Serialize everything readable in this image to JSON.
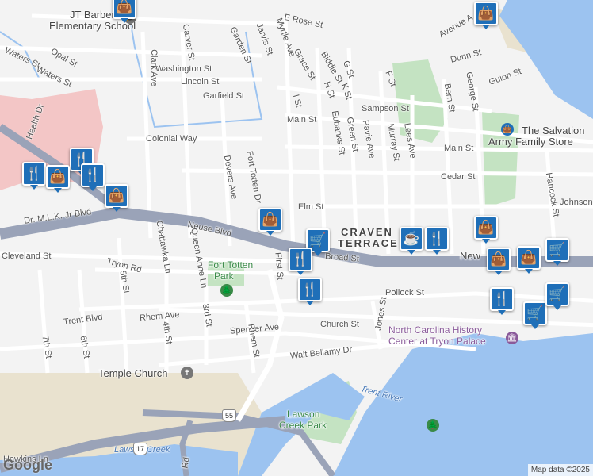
{
  "map": {
    "attribution": "Map data ©2025",
    "logo": "Google",
    "colors": {
      "water": "#9cc3f0",
      "park": "#c4e3c2",
      "highway": "#9aa3b8",
      "hospital": "#f3c6c6",
      "sand": "#e9e2cf",
      "pin": "#1f6fb8"
    }
  },
  "district": {
    "line1": "CRAVEN",
    "line2": "TERRACE"
  },
  "streets": [
    {
      "id": "jt-barber",
      "text": "JT Barber"
    },
    {
      "id": "jt-barber-2",
      "text": "Elementary School"
    },
    {
      "id": "e-rose",
      "text": "E Rose St"
    },
    {
      "id": "opal",
      "text": "Opal St"
    },
    {
      "id": "waters-1",
      "text": "Waters St"
    },
    {
      "id": "waters-2",
      "text": "Waters St"
    },
    {
      "id": "clark",
      "text": "Clark Ave"
    },
    {
      "id": "carver",
      "text": "Carver St"
    },
    {
      "id": "garden",
      "text": "Garden St"
    },
    {
      "id": "jarvis",
      "text": "Jarvis St"
    },
    {
      "id": "myrtle",
      "text": "Myrtle Ave"
    },
    {
      "id": "washington",
      "text": "Washington St"
    },
    {
      "id": "lincoln",
      "text": "Lincoln St"
    },
    {
      "id": "garfield",
      "text": "Garfield St"
    },
    {
      "id": "grace",
      "text": "Grace St"
    },
    {
      "id": "biddle",
      "text": "Biddle St"
    },
    {
      "id": "g-st",
      "text": "G St"
    },
    {
      "id": "f-st",
      "text": "F St"
    },
    {
      "id": "h-st",
      "text": "H St"
    },
    {
      "id": "k-st",
      "text": "K St"
    },
    {
      "id": "i-st",
      "text": "I St"
    },
    {
      "id": "sampson",
      "text": "Sampson St"
    },
    {
      "id": "main-1",
      "text": "Main St"
    },
    {
      "id": "main-2",
      "text": "Main St"
    },
    {
      "id": "eubanks",
      "text": "Eubanks St"
    },
    {
      "id": "green",
      "text": "Green St"
    },
    {
      "id": "pavie",
      "text": "Pavie Ave"
    },
    {
      "id": "murray",
      "text": "Murray St"
    },
    {
      "id": "lees",
      "text": "Lees Ave"
    },
    {
      "id": "bern",
      "text": "Bern St"
    },
    {
      "id": "george",
      "text": "George St"
    },
    {
      "id": "avenue-a",
      "text": "Avenue A"
    },
    {
      "id": "dunn",
      "text": "Dunn St"
    },
    {
      "id": "guion",
      "text": "Guion St"
    },
    {
      "id": "health",
      "text": "Health Dr"
    },
    {
      "id": "colonial",
      "text": "Colonial Way"
    },
    {
      "id": "devers",
      "text": "Devers Ave"
    },
    {
      "id": "fort-totten-dr",
      "text": "Fort Totten Dr"
    },
    {
      "id": "cedar",
      "text": "Cedar St"
    },
    {
      "id": "elm",
      "text": "Elm St"
    },
    {
      "id": "johnson",
      "text": "Johnson"
    },
    {
      "id": "hancock",
      "text": "Hancock St"
    },
    {
      "id": "mlk",
      "text": "Dr. M.L.K. Jr Blvd"
    },
    {
      "id": "neuse",
      "text": "Neuse Blvd"
    },
    {
      "id": "broad",
      "text": "Broad St"
    },
    {
      "id": "new",
      "text": "New"
    },
    {
      "id": "cleveland",
      "text": "Cleveland St"
    },
    {
      "id": "tryon",
      "text": "Tryon Rd"
    },
    {
      "id": "chattawka",
      "text": "Chattawka Ln"
    },
    {
      "id": "queen-anne",
      "text": "Queen Anne Ln"
    },
    {
      "id": "fifth",
      "text": "5th St"
    },
    {
      "id": "first",
      "text": "First St"
    },
    {
      "id": "pollock",
      "text": "Pollock St"
    },
    {
      "id": "trent-blvd",
      "text": "Trent Blvd"
    },
    {
      "id": "rhem-ave",
      "text": "Rhem Ave"
    },
    {
      "id": "third",
      "text": "3rd St"
    },
    {
      "id": "fourth",
      "text": "4th St"
    },
    {
      "id": "sixth",
      "text": "6th St"
    },
    {
      "id": "seventh",
      "text": "7th St"
    },
    {
      "id": "spencer",
      "text": "Spencer Ave"
    },
    {
      "id": "rhem-st",
      "text": "Rhem St"
    },
    {
      "id": "church",
      "text": "Church St"
    },
    {
      "id": "jones",
      "text": "Jones St"
    },
    {
      "id": "walt",
      "text": "Walt Bellamy Dr"
    },
    {
      "id": "lawson-creek",
      "text": "Lawson Creek"
    },
    {
      "id": "hawkins",
      "text": "Hawkins Ln"
    },
    {
      "id": "rd",
      "text": "Rd"
    }
  ],
  "places": {
    "salvation_1": "The Salvation",
    "salvation_2": "Army Family Store",
    "fort_totten_1": "Fort Totten",
    "fort_totten_2": "Park",
    "temple": "Temple Church",
    "nc_history_1": "North Carolina History",
    "nc_history_2": "Center at Tryon Palace",
    "trent_river": "Trent River",
    "lawson_park_1": "Lawson",
    "lawson_park_2": "Creek Park"
  },
  "routes": {
    "us17": "17",
    "nc55": "55"
  },
  "pins": [
    {
      "icon": "shopping-bag-icon",
      "glyph": "👜"
    },
    {
      "icon": "shopping-bag-icon",
      "glyph": "👜"
    },
    {
      "icon": "restaurant-icon",
      "glyph": "🍴"
    },
    {
      "icon": "restaurant-icon",
      "glyph": "🍴"
    },
    {
      "icon": "shopping-bag-icon",
      "glyph": "👜"
    },
    {
      "icon": "restaurant-icon",
      "glyph": "🍴"
    },
    {
      "icon": "shopping-bag-icon",
      "glyph": "👜"
    },
    {
      "icon": "shopping-bag-icon",
      "glyph": "👜"
    },
    {
      "icon": "shopping-cart-icon",
      "glyph": "🛒"
    },
    {
      "icon": "restaurant-icon",
      "glyph": "🍴"
    },
    {
      "icon": "restaurant-icon",
      "glyph": "🍴"
    },
    {
      "icon": "cafe-icon",
      "glyph": "☕"
    },
    {
      "icon": "restaurant-icon",
      "glyph": "🍴"
    },
    {
      "icon": "shopping-bag-icon",
      "glyph": "👜"
    },
    {
      "icon": "shopping-bag-icon",
      "glyph": "👜"
    },
    {
      "icon": "shopping-bag-icon",
      "glyph": "👜"
    },
    {
      "icon": "shopping-cart-icon",
      "glyph": "🛒"
    },
    {
      "icon": "restaurant-icon",
      "glyph": "🍴"
    },
    {
      "icon": "shopping-cart-icon",
      "glyph": "🛒"
    },
    {
      "icon": "shopping-cart-icon",
      "glyph": "🛒"
    }
  ]
}
